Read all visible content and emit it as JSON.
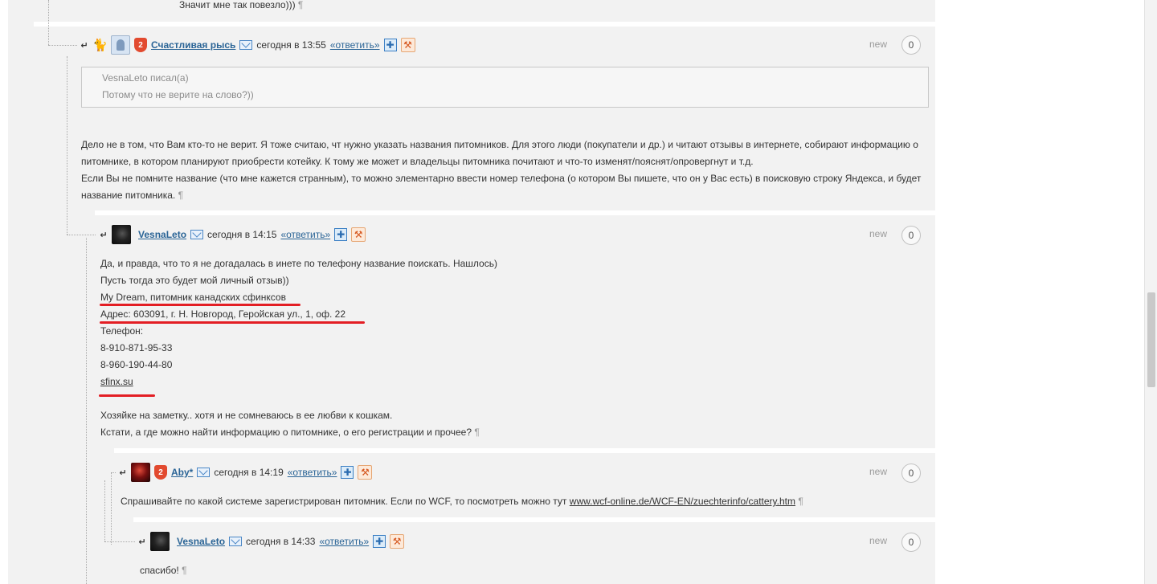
{
  "top_fragment": {
    "text": "Значит мне так повезло)))",
    "pilcrow": "¶"
  },
  "comments": [
    {
      "user": "Счастливая рысь",
      "time": "сегодня в 13:55",
      "reply": "«ответить»",
      "new": "new",
      "count": "0",
      "quote": {
        "author": "VesnaLeto писал(а)",
        "text": "Потому что не верите на слово?))"
      },
      "body": [
        "Дело не в том, что Вам кто-то не верит. Я тоже считаю, чт нужно указать названия питомников. Для этого люди (покупатели и др.) и читают отзывы в интернете, собирают информацию о",
        "питомнике, в котором планируют приобрести котейку. К тому же может и владельцы питомника почитают и что-то изменят/пояснят/опровергнут и т.д.",
        "Если Вы не помните название (что мне кажется странным), то можно элементарно ввести номер телефона (о котором Вы пишете, что он у Вас есть) в поисковую строку Яндекса, и будет",
        "название питомника."
      ],
      "pilcrow": "¶"
    },
    {
      "user": "VesnaLeto",
      "time": "сегодня в 14:15",
      "reply": "«ответить»",
      "new": "new",
      "count": "0",
      "body": [
        "Да, и правда, что то я не догадалась в инете по телефону название поискать. Нашлось)",
        "Пусть тогда это будет мой личный отзыв))",
        "My Dream, питомник канадских сфинксов",
        "Адрес: 603091, г. Н. Новгород, Геройская ул., 1, оф. 22",
        "Телефон:",
        "8-910-871-95-33",
        "8-960-190-44-80",
        "sfinx.su",
        "",
        "Хозяйке на заметку.. хотя и не сомневаюсь в ее любви к кошкам.",
        "Кстати, а где можно найти информацию о питомнике, о его регистрации и прочее?"
      ],
      "pilcrow": "¶"
    },
    {
      "user": "Aby*",
      "time": "сегодня в 14:19",
      "reply": "«ответить»",
      "new": "new",
      "count": "0",
      "body_prefix": "Спрашивайте по какой системе зарегистрирован питомник. Если по WCF, то посмотреть можно тут",
      "link": "www.wcf-online.de/WCF-EN/zuechterinfo/cattery.htm",
      "pilcrow": "¶"
    },
    {
      "user": "VesnaLeto",
      "time": "сегодня в 14:33",
      "reply": "«ответить»",
      "new": "new",
      "count": "0",
      "body": "спасибо!",
      "pilcrow": "¶"
    }
  ],
  "icons": {
    "reply_arrow": "reply-arrow-icon",
    "cat": "cat-icon",
    "rank": "rank-2-badge-icon",
    "mail": "mail-icon",
    "gift": "gift-icon",
    "hammer": "hammer-icon"
  },
  "rank_level": "2",
  "colors": {
    "username": "#2a6496",
    "highlight_underline": "#e31e24",
    "background": "#f2f2f2"
  }
}
